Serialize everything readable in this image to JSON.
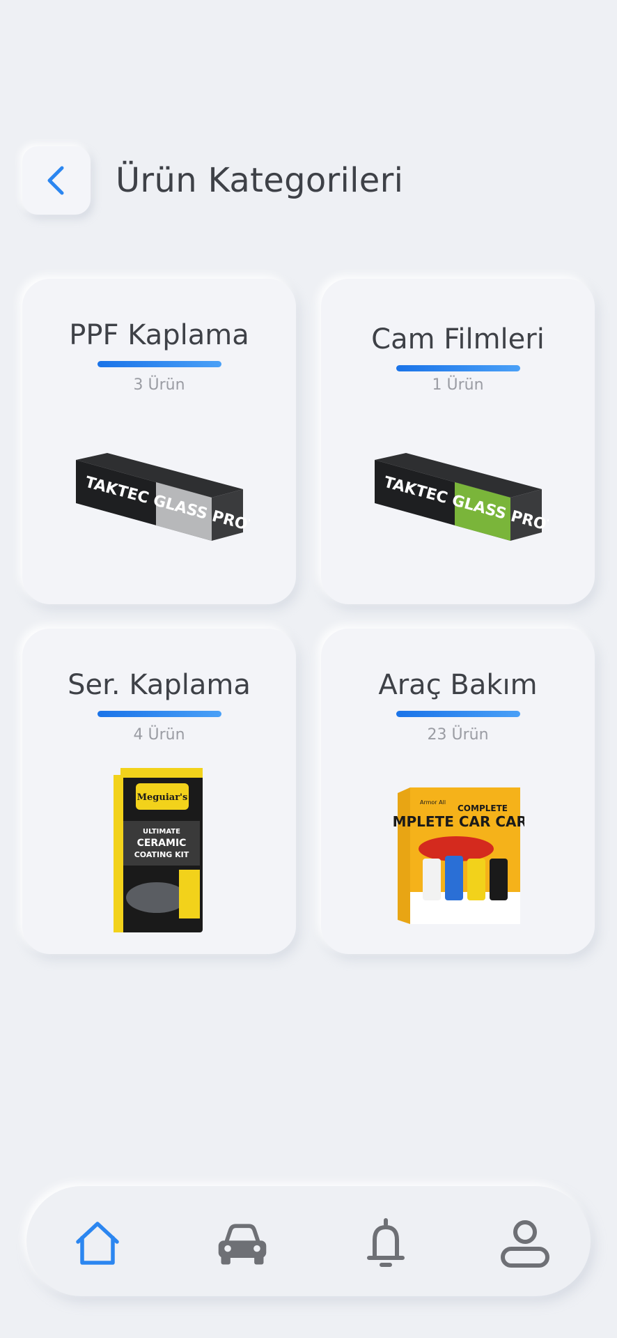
{
  "header": {
    "title": "Ürün Kategorileri",
    "back_icon": "chevron-left-icon"
  },
  "colors": {
    "accent": "#1a73e8",
    "background": "#eef0f4",
    "text": "#3e4147",
    "muted": "#9a9ca3"
  },
  "categories": [
    {
      "name": "PPF Kaplama",
      "count": "3 Ürün",
      "image_label": "TAKTEC GLASS PROTECTOR",
      "image_sublabel": "GLASS PROTECTOR"
    },
    {
      "name": "Cam Filmleri",
      "count": "1 Ürün",
      "image_label": "TAKTEC GLASS PROTECTOR",
      "image_sublabel": "GLASS PROTECTOR"
    },
    {
      "name": "Ser. Kaplama",
      "count": "4 Ürün",
      "image_label": "ULTIMATE CERAMIC COATING KIT",
      "image_sublabel": "Meguiar's"
    },
    {
      "name": "Araç Bakım",
      "count": "23 Ürün",
      "image_label": "COMPLETE CAR CARE KIT",
      "image_sublabel": "Armor All"
    }
  ],
  "bottom_nav": {
    "items": [
      {
        "icon": "home-icon",
        "active": true
      },
      {
        "icon": "car-icon",
        "active": false
      },
      {
        "icon": "bell-icon",
        "active": false
      },
      {
        "icon": "user-icon",
        "active": false
      }
    ]
  }
}
